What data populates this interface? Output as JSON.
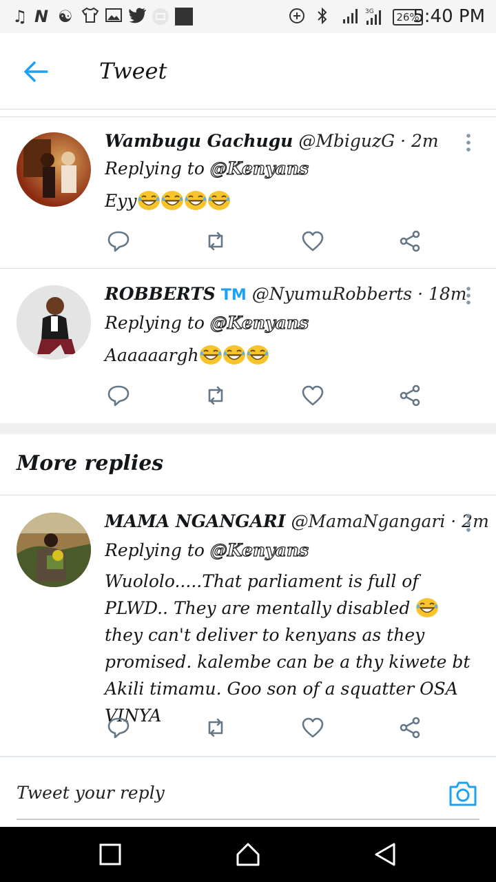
{
  "status_bar": {
    "time": "5:40 PM",
    "battery": "26%",
    "network": "3G",
    "icons": [
      "music-icon",
      "n-app-icon",
      "bitmoji-icon",
      "shirt-icon",
      "gallery-icon",
      "twitter-icon",
      "mail-icon",
      "square-app-icon",
      "data-saver-icon",
      "bluetooth-icon",
      "signal-icon",
      "signal-3g-icon",
      "battery-icon"
    ]
  },
  "header": {
    "title": "Tweet",
    "back_icon": "arrow-left-icon"
  },
  "tweets": [
    {
      "name": "Wambugu Gachugu",
      "badge": "",
      "handle": "@MbiguzG",
      "time": "· 2m",
      "replying_prefix": "Replying to",
      "replying_to": "@Kenyans",
      "text": "Eyy",
      "emoji_count": 4
    },
    {
      "name": "ROBBERTS",
      "badge": "TM",
      "handle": "@NyumuRobberts",
      "time": "· 18m",
      "replying_prefix": "Replying to",
      "replying_to": "@Kenyans",
      "text": "Aaaaaargh",
      "emoji_count": 3
    }
  ],
  "more_replies": {
    "title": "More replies",
    "tweet": {
      "name": "MAMA NGANGARI",
      "handle": "@MamaNgangari",
      "time": "· 2m",
      "replying_prefix": "Replying to",
      "replying_to": "@Kenyans",
      "text_before_emoji": "Wuololo.....That parliament is full of PLWD.. They are mentally disabled ",
      "text_after_emoji": " they can't deliver to kenyans as they promised. kalembe can be a thy kiwete bt Akili timamu. Goo son of a squatter OSA VINYA"
    }
  },
  "actions": [
    "reply-icon",
    "retweet-icon",
    "like-icon",
    "share-icon"
  ],
  "reply_box": {
    "placeholder": "Tweet your reply",
    "camera_icon": "camera-icon"
  },
  "nav_bar": {
    "buttons": [
      "recents-square-icon",
      "home-icon",
      "back-triangle-icon"
    ]
  },
  "colors": {
    "accent": "#1da1f2",
    "icon_gray": "#657786",
    "tm_badge": "#1da1f2",
    "emoji_yellow": "#f7c52b"
  }
}
